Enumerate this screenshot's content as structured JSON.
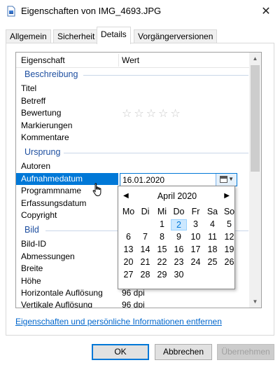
{
  "window": {
    "title": "Eigenschaften von IMG_4693.JPG"
  },
  "tabs": [
    {
      "label": "Allgemein"
    },
    {
      "label": "Sicherheit"
    },
    {
      "label": "Details"
    },
    {
      "label": "Vorgängerversionen"
    }
  ],
  "list": {
    "header": {
      "property": "Eigenschaft",
      "value": "Wert"
    },
    "groups": {
      "description": "Beschreibung",
      "origin": "Ursprung",
      "image": "Bild"
    },
    "rows": {
      "title": {
        "name": "Titel",
        "value": ""
      },
      "subject": {
        "name": "Betreff",
        "value": ""
      },
      "rating": {
        "name": "Bewertung",
        "value": "☆☆☆☆☆"
      },
      "tags": {
        "name": "Markierungen",
        "value": ""
      },
      "comments": {
        "name": "Kommentare",
        "value": ""
      },
      "authors": {
        "name": "Autoren",
        "value": ""
      },
      "date_taken": {
        "name": "Aufnahmedatum",
        "value": "16.01.2020"
      },
      "program": {
        "name": "Programmname",
        "value": ""
      },
      "date_acquired": {
        "name": "Erfassungsdatum",
        "value": ""
      },
      "copyright": {
        "name": "Copyright",
        "value": ""
      },
      "image_id": {
        "name": "Bild-ID",
        "value": ""
      },
      "dimensions": {
        "name": "Abmessungen",
        "value": ""
      },
      "width": {
        "name": "Breite",
        "value": ""
      },
      "height": {
        "name": "Höhe",
        "value": ""
      },
      "hres": {
        "name": "Horizontale Auflösung",
        "value": "96 dpi"
      },
      "vres": {
        "name": "Vertikale Auflösung",
        "value": "96 dpi"
      }
    }
  },
  "calendar": {
    "prev": "◀",
    "next": "▶",
    "month": "April 2020",
    "weekdays": [
      "Mo",
      "Di",
      "Mi",
      "Do",
      "Fr",
      "Sa",
      "So"
    ],
    "weeks": [
      [
        "",
        "",
        "1",
        "2",
        "3",
        "4",
        "5"
      ],
      [
        "6",
        "7",
        "8",
        "9",
        "10",
        "11",
        "12"
      ],
      [
        "13",
        "14",
        "15",
        "16",
        "17",
        "18",
        "19"
      ],
      [
        "20",
        "21",
        "22",
        "23",
        "24",
        "25",
        "26"
      ],
      [
        "27",
        "28",
        "29",
        "30",
        "",
        "",
        ""
      ]
    ],
    "today": "2"
  },
  "footer_link": "Eigenschaften und persönliche Informationen entfernen",
  "buttons": {
    "ok": "OK",
    "cancel": "Abbrechen",
    "apply": "Übernehmen"
  },
  "colors": {
    "accent": "#0078d7",
    "group_heading": "#1e4fa0",
    "link": "#0066cc"
  }
}
